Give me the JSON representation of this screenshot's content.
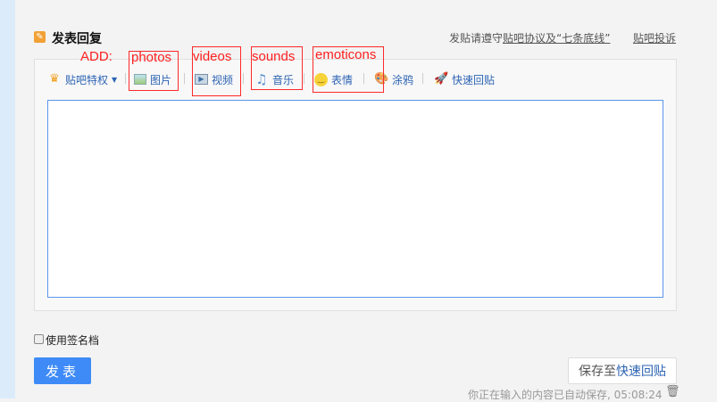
{
  "header": {
    "title": "发表回复",
    "rule_prefix": "发贴请遵守",
    "rule_link": "贴吧协议及“七条底线”",
    "complain": "贴吧投诉"
  },
  "annotations": {
    "add": "ADD:",
    "photos": "photos",
    "videos": "videos",
    "sounds": "sounds",
    "emoticons": "emoticons"
  },
  "toolbar": {
    "privilege": "贴吧特权",
    "picture": "图片",
    "video": "视频",
    "music": "音乐",
    "emotion": "表情",
    "doodle": "涂鸦",
    "quick_reply": "快速回贴"
  },
  "editor": {
    "value": ""
  },
  "footer": {
    "signature": "使用签名档",
    "post": "发表",
    "save_prefix": "保存至",
    "save_link": "快速回贴",
    "autosave": "你正在输入的内容已自动保存, 05:08:24"
  },
  "colors": {
    "accent": "#3e8bf8",
    "link": "#2d64b3",
    "annotation": "#ff2020"
  }
}
